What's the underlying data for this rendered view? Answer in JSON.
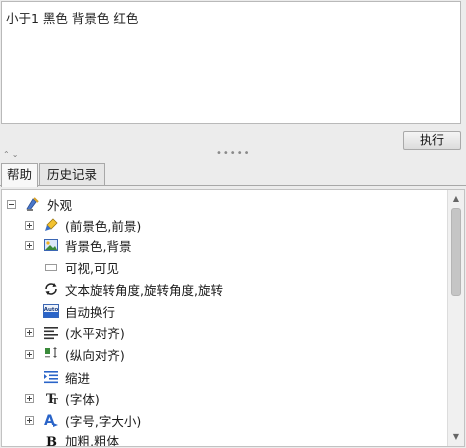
{
  "query": {
    "text": "小于1 黑色 背景色 红色"
  },
  "toolbar": {
    "run_label": "执行",
    "collapse_arrows": "⌃⌄",
    "grip": "•••••"
  },
  "tabs": [
    {
      "label": "帮助",
      "active": true
    },
    {
      "label": "历史记录",
      "active": false
    }
  ],
  "tree": {
    "root": {
      "label": "外观",
      "expanded": true,
      "icon": "appearance-icon"
    },
    "items": [
      {
        "label": "(前景色,前景)",
        "expandable": true,
        "icon": "paintbrush-icon"
      },
      {
        "label": "背景色,背景",
        "expandable": true,
        "icon": "background-image-icon"
      },
      {
        "label": "可视,可见",
        "expandable": false,
        "icon": "visible-box-icon"
      },
      {
        "label": "文本旋转角度,旋转角度,旋转",
        "expandable": false,
        "icon": "rotate-icon"
      },
      {
        "label": "自动换行",
        "expandable": false,
        "icon": "auto-wrap-icon",
        "icon_text": "Auto"
      },
      {
        "label": "(水平对齐)",
        "expandable": true,
        "icon": "align-horizontal-icon"
      },
      {
        "label": "(纵向对齐)",
        "expandable": true,
        "icon": "align-vertical-icon"
      },
      {
        "label": "缩进",
        "expandable": false,
        "icon": "indent-icon"
      },
      {
        "label": "(字体)",
        "expandable": true,
        "icon": "font-icon",
        "icon_text": "T"
      },
      {
        "label": "(字号,字大小)",
        "expandable": true,
        "icon": "font-size-icon",
        "icon_text": "A"
      },
      {
        "label": "加粗,粗体",
        "expandable": false,
        "icon": "bold-icon",
        "icon_text": "B"
      }
    ]
  },
  "colors": {
    "accent_blue": "#2a64c8",
    "panel_bg": "#ececec"
  }
}
